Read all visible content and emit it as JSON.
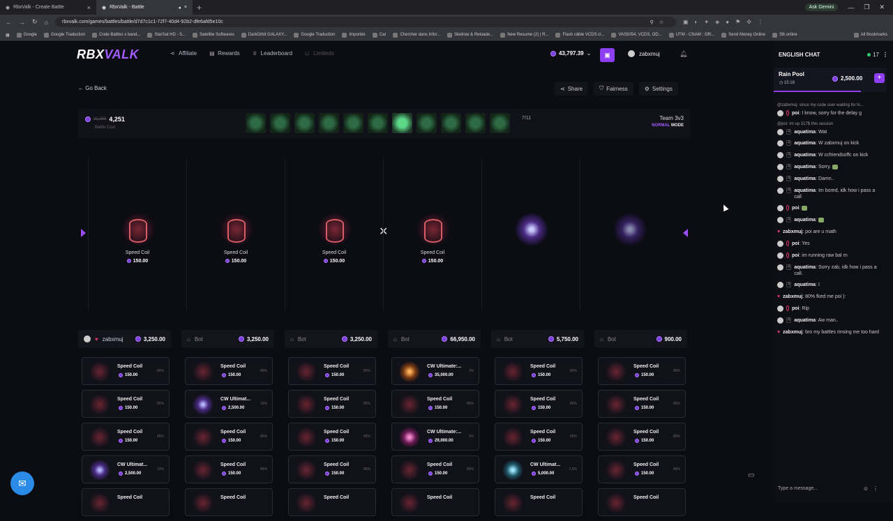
{
  "browser": {
    "tabs": [
      {
        "label": "RbxValk - Create Battle",
        "active": false
      },
      {
        "label": "RbxValk - Battle",
        "active": true
      }
    ],
    "gemini_label": "Ask Gemini",
    "url": "rbxvalk.com/games/battles/battle/d7d7c1c1-72f7-40d4-92b2-dfe6afd5e10c",
    "bookmarks": [
      "Google",
      "Google Traduction",
      "Crate Battles x band...",
      "StarSat HD - S...",
      "Satellite Softwares",
      "DarkOrbit GALAXY...",
      "Google Traduction",
      "Importés",
      "Car",
      "Chercher dans Infor...",
      "Skidrow & Reloade...",
      "New Resume (2) | R...",
      "Flash câble VCDS cl...",
      "VAS5054, VCDS, OD...",
      "UTM - CNAM : Offr...",
      "Send Money Online",
      "SB online"
    ],
    "all_bookmarks": "All Bookmarks"
  },
  "nav": {
    "logo_a": "RBX",
    "logo_b": "VALK",
    "links": [
      "Affiliate",
      "Rewards",
      "Leaderboard",
      "Limiteds"
    ],
    "balance": "43,797.39",
    "username": "zabxmuj"
  },
  "battle": {
    "go_back": "Go Back",
    "actions": [
      "Share",
      "Fairness",
      "Settings"
    ],
    "old_cost": "21,256",
    "cost": "4,251",
    "cost_label": "Battle Cost",
    "case_count": 11,
    "highlight_case": 7,
    "round_text": "7/11",
    "team": "Team 3v3",
    "mode_word": "NORMAL",
    "mode_suffix": "MODE",
    "vs": "✕",
    "reel": [
      {
        "name": "Speed Coil",
        "value": "150.00",
        "kind": "coil"
      },
      {
        "name": "Speed Coil",
        "value": "150.00",
        "kind": "coil"
      },
      {
        "name": "Speed Coil",
        "value": "150.00",
        "kind": "coil"
      },
      {
        "name": "Speed Coil",
        "value": "150.00",
        "kind": "coil"
      },
      {
        "name": "",
        "value": "",
        "kind": "cw"
      },
      {
        "name": "",
        "value": "",
        "kind": "cw-dim"
      }
    ]
  },
  "players": [
    {
      "name": "zabxmuj",
      "is_bot": false,
      "total": "3,250.00",
      "drops": [
        {
          "name": "Speed Coil",
          "value": "150.00",
          "pct": "85%",
          "kind": "coil"
        },
        {
          "name": "Speed Coil",
          "value": "150.00",
          "pct": "85%",
          "kind": "coil"
        },
        {
          "name": "Speed Coil",
          "value": "150.00",
          "pct": "85%",
          "kind": "coil"
        },
        {
          "name": "CW Ultimat...",
          "value": "2,500.00",
          "pct": "10%",
          "kind": "cw"
        },
        {
          "name": "Speed Coil",
          "value": "",
          "pct": "",
          "kind": "coil"
        }
      ]
    },
    {
      "name": "Bot",
      "is_bot": true,
      "total": "3,250.00",
      "drops": [
        {
          "name": "Speed Coil",
          "value": "150.00",
          "pct": "85%",
          "kind": "coil"
        },
        {
          "name": "CW Ultimat...",
          "value": "2,500.00",
          "pct": "10%",
          "kind": "cw"
        },
        {
          "name": "Speed Coil",
          "value": "150.00",
          "pct": "85%",
          "kind": "coil"
        },
        {
          "name": "Speed Coil",
          "value": "150.00",
          "pct": "85%",
          "kind": "coil"
        },
        {
          "name": "Speed Coil",
          "value": "",
          "pct": "",
          "kind": "coil"
        }
      ]
    },
    {
      "name": "Bot",
      "is_bot": true,
      "total": "3,250.00",
      "drops": [
        {
          "name": "Speed Coil",
          "value": "150.00",
          "pct": "85%",
          "kind": "coil"
        },
        {
          "name": "Speed Coil",
          "value": "150.00",
          "pct": "85%",
          "kind": "coil"
        },
        {
          "name": "Speed Coil",
          "value": "150.00",
          "pct": "85%",
          "kind": "coil"
        },
        {
          "name": "Speed Coil",
          "value": "150.00",
          "pct": "85%",
          "kind": "coil"
        },
        {
          "name": "Speed Coil",
          "value": "",
          "pct": "",
          "kind": "coil"
        }
      ]
    },
    {
      "name": "Bot",
      "is_bot": true,
      "total": "66,950.00",
      "drops": [
        {
          "name": "CW Ultimate:...",
          "value": "35,000.00",
          "pct": "1%",
          "kind": "orange"
        },
        {
          "name": "Speed Coil",
          "value": "150.00",
          "pct": "85%",
          "kind": "coil"
        },
        {
          "name": "CW Ultimate:...",
          "value": "29,000.00",
          "pct": "1%",
          "kind": "pink"
        },
        {
          "name": "Speed Coil",
          "value": "150.00",
          "pct": "85%",
          "kind": "coil"
        },
        {
          "name": "Speed Coil",
          "value": "",
          "pct": "",
          "kind": "coil"
        }
      ]
    },
    {
      "name": "Bot",
      "is_bot": true,
      "total": "5,750.00",
      "drops": [
        {
          "name": "Speed Coil",
          "value": "150.00",
          "pct": "85%",
          "kind": "coil"
        },
        {
          "name": "Speed Coil",
          "value": "150.00",
          "pct": "85%",
          "kind": "coil"
        },
        {
          "name": "Speed Coil",
          "value": "150.00",
          "pct": "85%",
          "kind": "coil"
        },
        {
          "name": "CW Ultimat...",
          "value": "5,000.00",
          "pct": "2.5%",
          "kind": "teal"
        },
        {
          "name": "Speed Coil",
          "value": "",
          "pct": "",
          "kind": "coil"
        }
      ]
    },
    {
      "name": "Bot",
      "is_bot": true,
      "total": "900.00",
      "drops": [
        {
          "name": "Speed Coil",
          "value": "150.00",
          "pct": "85%",
          "kind": "coil"
        },
        {
          "name": "Speed Coil",
          "value": "150.00",
          "pct": "85%",
          "kind": "coil"
        },
        {
          "name": "Speed Coil",
          "value": "150.00",
          "pct": "85%",
          "kind": "coil"
        },
        {
          "name": "Speed Coil",
          "value": "150.00",
          "pct": "85%",
          "kind": "coil"
        },
        {
          "name": "Speed Coil",
          "value": "",
          "pct": "",
          "kind": "coil"
        }
      ]
    }
  ],
  "chat": {
    "title": "ENGLISH CHAT",
    "online": "17",
    "rain_title": "Rain Pool",
    "rain_time": "15:18",
    "rain_amount": "2,500.00",
    "rain_progress": 0.77,
    "placeholder": "Type a message...",
    "messages": [
      {
        "reply": "@zabxmuj: since my code user waiting for hi...",
        "user": "poi",
        "text": "I know, sorry for the delay g",
        "lvl": "",
        "red": true
      },
      {
        "reply": "@poi: im up 317$ this session",
        "user": "aquatima",
        "text": "Wat",
        "lvl": "4",
        "red": false
      },
      {
        "reply": "",
        "user": "aquatima",
        "text": "W zabxmuj on kick",
        "lvl": "4",
        "red": false
      },
      {
        "reply": "",
        "user": "aquatima",
        "text": "W ccfriendsoffc on kick",
        "lvl": "4",
        "red": false
      },
      {
        "reply": "",
        "user": "aquatima",
        "text": "Sorry.",
        "lvl": "4",
        "red": false,
        "emoji": true
      },
      {
        "reply": "",
        "user": "aquatima",
        "text": "Damn..",
        "lvl": "4",
        "red": false
      },
      {
        "reply": "",
        "user": "aquatima",
        "text": "Im bored, idk how i pass a call",
        "lvl": "4",
        "red": false
      },
      {
        "reply": "",
        "user": "poi",
        "text": "",
        "lvl": "",
        "red": true,
        "emoji": true
      },
      {
        "reply": "",
        "user": "aquatima",
        "text": "",
        "lvl": "4",
        "red": false,
        "emoji": true
      },
      {
        "reply": "",
        "user": "zabxmuj",
        "text": "poi are u math",
        "lvl": "",
        "red": false,
        "heart": true
      },
      {
        "reply": "",
        "user": "poi",
        "text": "Yes",
        "lvl": "",
        "red": true
      },
      {
        "reply": "",
        "user": "poi",
        "text": "im running raw bal rn",
        "lvl": "",
        "red": true
      },
      {
        "reply": "",
        "user": "aquatima",
        "text": "Sorry zab, idk how i pass a call.",
        "lvl": "4",
        "red": false
      },
      {
        "reply": "",
        "user": "aquatima",
        "text": "I",
        "lvl": "4",
        "red": false
      },
      {
        "reply": "",
        "user": "zabxmuj",
        "text": "80% fked me poi ):",
        "lvl": "",
        "red": false,
        "heart": true
      },
      {
        "reply": "",
        "user": "poi",
        "text": "Rip",
        "lvl": "",
        "red": true
      },
      {
        "reply": "",
        "user": "aquatima",
        "text": "Aw man..",
        "lvl": "4",
        "red": false
      },
      {
        "reply": "",
        "user": "zabxmuj",
        "text": "bro my battles rinsing me too hard",
        "lvl": "",
        "red": false,
        "heart": true
      }
    ]
  }
}
